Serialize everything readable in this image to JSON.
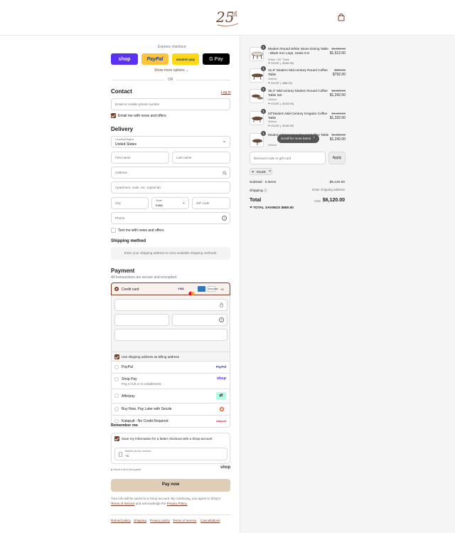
{
  "header": {
    "logo": "25th anniversary logo",
    "cart_icon": "shopping-bag-icon"
  },
  "express": {
    "title": "Express checkout",
    "shop": "shop",
    "paypal": "PayPal",
    "amazon": "amazon pay",
    "gpay": "G Pay",
    "more": "Show more options",
    "or": "OR"
  },
  "contact": {
    "title": "Contact",
    "login": "Log in",
    "email_placeholder": "Email or mobile phone number",
    "news": "Email me with news and offers"
  },
  "delivery": {
    "title": "Delivery",
    "country_label": "Country/Region",
    "country": "United States",
    "first": "First name",
    "last": "Last name",
    "address": "Address",
    "apt": "Apartment, suite, etc. (optional)",
    "city": "City",
    "state_label": "State",
    "state": "Iowa",
    "zip": "ZIP code",
    "phone": "Phone",
    "text_me": "Text me with news and offers"
  },
  "shipping": {
    "title": "Shipping method",
    "msg": "Enter your shipping address to view available shipping methods."
  },
  "payment": {
    "title": "Payment",
    "sub": "All transactions are secure and encrypted.",
    "credit": "Credit card",
    "more_cards": "+5",
    "billing": "Use shipping address as billing address",
    "options": [
      {
        "label": "PayPal",
        "logo": "PayPal"
      },
      {
        "label": "Shop Pay",
        "sub": "Pay in full or in installments",
        "logo": "shop"
      },
      {
        "label": "Afterpay",
        "logo": "afterpay-icon"
      },
      {
        "label": "Buy Now, Pay Later with Sezzle",
        "logo": "sezzle-icon"
      },
      {
        "label": "Katapult - No Credit Required",
        "logo": "katapult"
      }
    ]
  },
  "remember": {
    "title": "Remember me",
    "save": "Save my information for a faster checkout with a Shop account",
    "phone_label": "Mobile phone number",
    "phone_value": "+1",
    "secure": "Secure and encrypted",
    "shop": "shop"
  },
  "pay_now": "Pay now",
  "legal": {
    "text": "Your info will be saved to a Shop account. By continuing, you agree to Shop's",
    "tos": "Terms of Service",
    "mid": "and acknowledge the",
    "privacy": "Privacy Policy."
  },
  "footer": [
    "Refund policy",
    "Shipping",
    "Privacy policy",
    "Terms of service",
    "Cancellations"
  ],
  "cart": {
    "items": [
      {
        "qty": "1",
        "name": "Modern Round White Stone Dining Table - Black Iron Legs, Seats 6-8",
        "variant": "White / 55\" Table",
        "discount": "KILEE ( -$168.00)",
        "old": "$1,680.00",
        "new": "$1,512.00"
      },
      {
        "qty": "1",
        "name": "31.5\" Modern Mid-century Round Coffee Table",
        "variant": "Walnut",
        "discount": "KILEE ( -$88.00)",
        "old": "$880.00",
        "new": "$792.00"
      },
      {
        "qty": "1",
        "name": "35.4\" Mid-century Modern Round Coffee Table Set",
        "variant": "Walnut",
        "discount": "KILEE ( -$138.00)",
        "old": "$1,380.00",
        "new": "$1,242.00"
      },
      {
        "qty": "1",
        "name": "63\"Modern Mid-Century Irregular Coffee Table",
        "variant": "Walnut",
        "discount": "KILEE ( -$148.00)",
        "old": "$1,480.00",
        "new": "$1,332.00"
      },
      {
        "qty": "1",
        "name": "Modern Mid-Century Round Coffee Table",
        "variant": "Walnut",
        "discount": "",
        "old": "$1,380.00",
        "new": "$1,242.00"
      }
    ],
    "scroll_tip": "Scroll for more items",
    "discount_placeholder": "Discount code or gift card",
    "apply": "Apply",
    "code": "KILEE",
    "subtotal_label": "Subtotal · 5 items",
    "subtotal": "$6,120.00",
    "shipping_label": "Shipping",
    "shipping_value": "Enter shipping address",
    "total_label": "Total",
    "currency": "USD",
    "total": "$6,120.00",
    "savings_label": "TOTAL SAVINGS",
    "savings": "$680.00"
  },
  "colors": {
    "accent": "#7a3e2b",
    "pay_button": "#dfcdb8",
    "shop": "#5a31f4",
    "paypal": "#ffc439",
    "amazon": "#ffd814",
    "gpay": "#000000"
  }
}
